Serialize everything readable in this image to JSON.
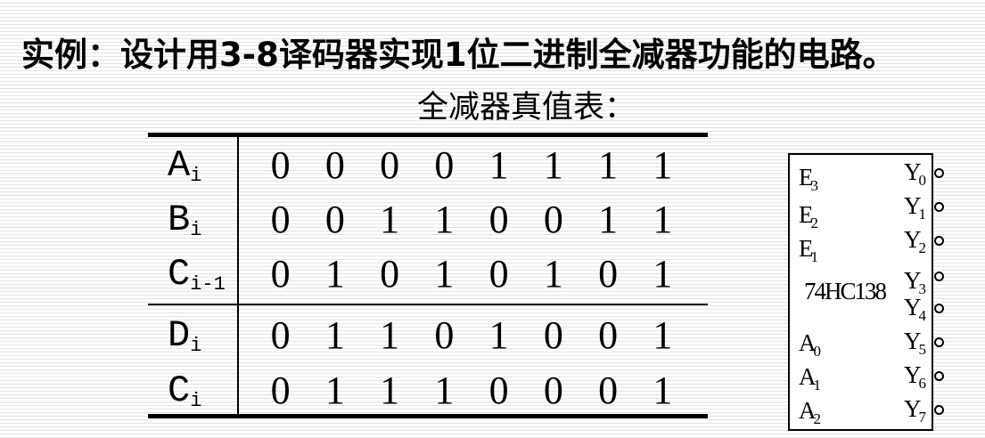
{
  "title": "实例：设计用3-8译码器实现1位二进制全减器功能的电路。",
  "subtitle": "全减器真值表：",
  "truth_table": {
    "rows": [
      {
        "label": "A",
        "sub": "i",
        "values": [
          "0",
          "0",
          "0",
          "0",
          "1",
          "1",
          "1",
          "1"
        ]
      },
      {
        "label": "B",
        "sub": "i",
        "values": [
          "0",
          "0",
          "1",
          "1",
          "0",
          "0",
          "1",
          "1"
        ]
      },
      {
        "label": "C",
        "sub": "i-1",
        "values": [
          "0",
          "1",
          "0",
          "1",
          "0",
          "1",
          "0",
          "1"
        ]
      },
      {
        "label": "D",
        "sub": "i",
        "values": [
          "0",
          "1",
          "1",
          "0",
          "1",
          "0",
          "0",
          "1"
        ]
      },
      {
        "label": "C",
        "sub": "i",
        "values": [
          "0",
          "1",
          "1",
          "1",
          "0",
          "0",
          "0",
          "1"
        ]
      }
    ]
  },
  "chip": {
    "name": "74HC138",
    "enable_inputs": [
      {
        "label": "E",
        "sub": "3"
      },
      {
        "label": "E",
        "sub": "2"
      },
      {
        "label": "E",
        "sub": "1"
      }
    ],
    "address_inputs": [
      {
        "label": "A",
        "sub": "0"
      },
      {
        "label": "A",
        "sub": "1"
      },
      {
        "label": "A",
        "sub": "2"
      }
    ],
    "outputs": [
      {
        "label": "Y",
        "sub": "0"
      },
      {
        "label": "Y",
        "sub": "1"
      },
      {
        "label": "Y",
        "sub": "2"
      },
      {
        "label": "Y",
        "sub": "3"
      },
      {
        "label": "Y",
        "sub": "4"
      },
      {
        "label": "Y",
        "sub": "5"
      },
      {
        "label": "Y",
        "sub": "6"
      },
      {
        "label": "Y",
        "sub": "7"
      }
    ]
  }
}
